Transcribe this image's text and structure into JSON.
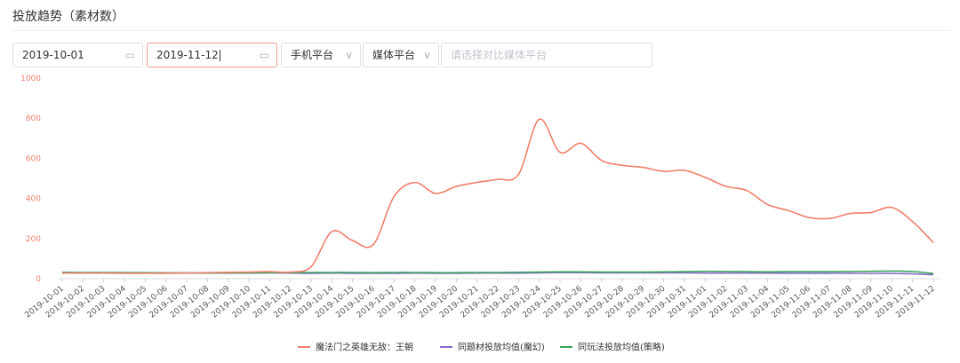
{
  "section_title": "投放趋势（素材数）",
  "filters": {
    "start_date": "2019-10-01",
    "end_date": "2019-11-12",
    "platform_select": "手机平台",
    "media_select": "媒体平台",
    "compare_placeholder": "请选择对比媒体平台"
  },
  "icons": {
    "calendar": "calendar-icon",
    "chevron": "chevron-down-icon"
  },
  "colors": {
    "accent": "#f0998c",
    "series1": "#f07f6b",
    "series2": "#8a6cc9",
    "series3": "#3aa55a",
    "yaxis_label": "#f07f6b"
  },
  "chart_data": {
    "type": "line",
    "ylim": [
      0,
      1000
    ],
    "yticks": [
      0,
      200,
      400,
      600,
      800,
      1000
    ],
    "categories": [
      "2019-10-01",
      "2019-10-02",
      "2019-10-03",
      "2019-10-04",
      "2019-10-05",
      "2019-10-06",
      "2019-10-07",
      "2019-10-08",
      "2019-10-09",
      "2019-10-10",
      "2019-10-11",
      "2019-10-12",
      "2019-10-13",
      "2019-10-14",
      "2019-10-15",
      "2019-10-16",
      "2019-10-17",
      "2019-10-18",
      "2019-10-19",
      "2019-10-20",
      "2019-10-21",
      "2019-10-22",
      "2019-10-23",
      "2019-10-24",
      "2019-10-25",
      "2019-10-26",
      "2019-10-27",
      "2019-10-28",
      "2019-10-29",
      "2019-10-30",
      "2019-10-31",
      "2019-11-01",
      "2019-11-02",
      "2019-11-03",
      "2019-11-04",
      "2019-11-05",
      "2019-11-06",
      "2019-11-07",
      "2019-11-08",
      "2019-11-09",
      "2019-11-10",
      "2019-11-11",
      "2019-11-12"
    ],
    "series": [
      {
        "name": "魔法门之英雄无敌：王朝",
        "color": "#f07f6b",
        "values": [
          28,
          28,
          28,
          27,
          27,
          27,
          28,
          30,
          32,
          33,
          35,
          33,
          60,
          235,
          190,
          170,
          410,
          480,
          425,
          460,
          480,
          495,
          520,
          795,
          630,
          675,
          590,
          565,
          555,
          535,
          540,
          505,
          460,
          440,
          370,
          340,
          305,
          300,
          325,
          330,
          355,
          285,
          180
        ]
      },
      {
        "name": "同题材投放均值(魔幻)",
        "color": "#8a6cc9",
        "values": [
          30,
          29,
          29,
          28,
          28,
          28,
          28,
          28,
          28,
          28,
          29,
          28,
          27,
          28,
          27,
          27,
          27,
          28,
          27,
          27,
          28,
          28,
          28,
          29,
          30,
          30,
          29,
          29,
          29,
          29,
          29,
          28,
          28,
          28,
          28,
          27,
          27,
          27,
          27,
          26,
          26,
          24,
          20
        ]
      },
      {
        "name": "同玩法投放均值(策略)",
        "color": "#3aa55a",
        "values": [
          32,
          31,
          31,
          30,
          30,
          29,
          29,
          28,
          29,
          29,
          30,
          30,
          31,
          31,
          31,
          30,
          31,
          31,
          30,
          30,
          31,
          31,
          32,
          33,
          34,
          34,
          33,
          33,
          33,
          34,
          35,
          37,
          36,
          35,
          34,
          35,
          35,
          35,
          36,
          37,
          38,
          36,
          26
        ]
      }
    ],
    "legend_position": "bottom-center"
  }
}
